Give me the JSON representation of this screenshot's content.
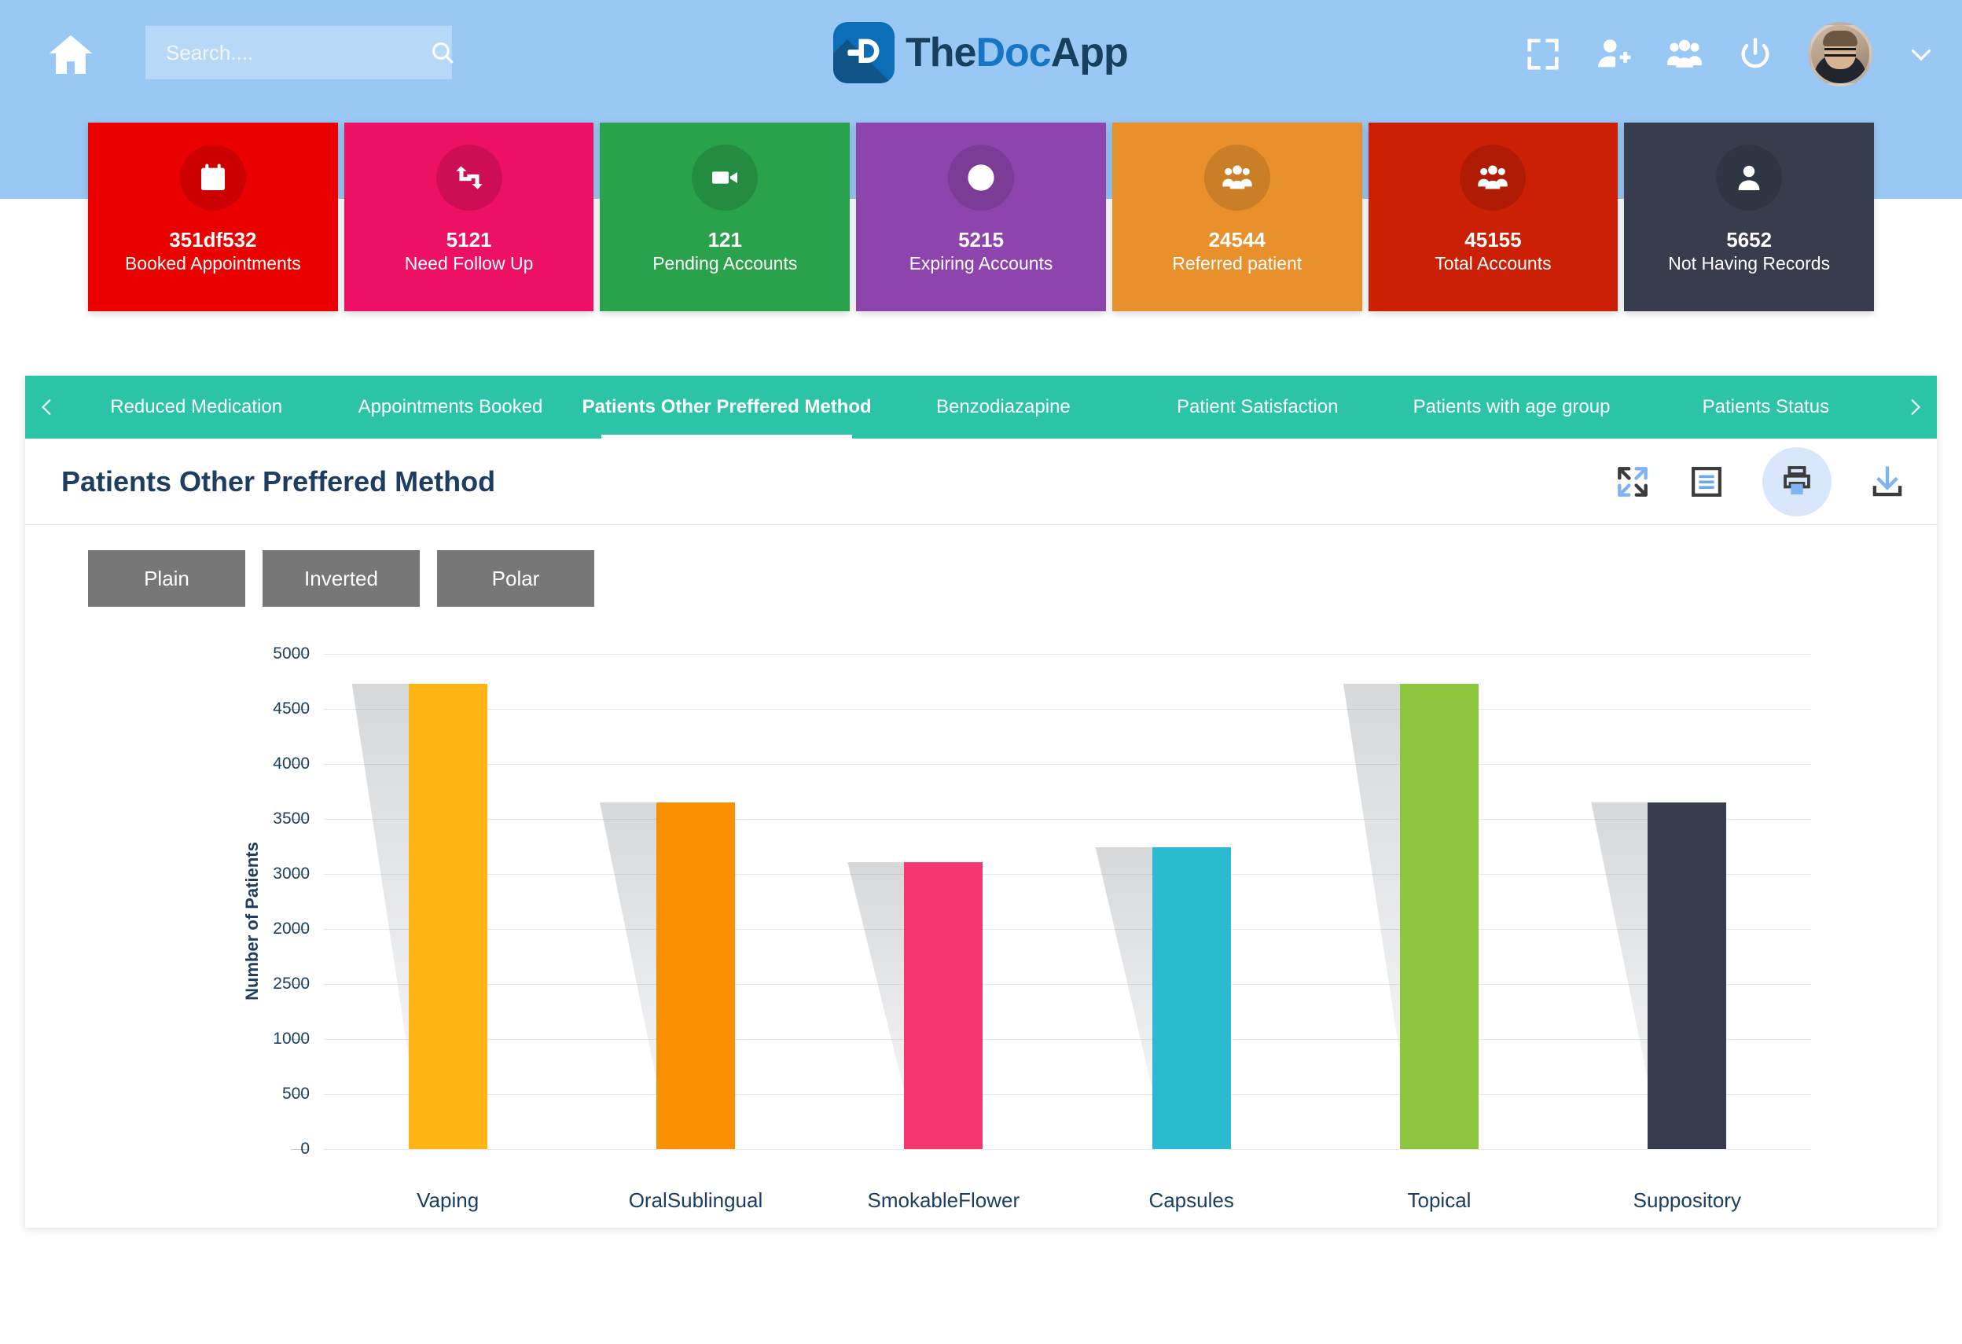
{
  "topbar": {
    "home_icon": "home-icon",
    "search": {
      "placeholder": "Search....",
      "value": "",
      "icon": "search-icon"
    },
    "brand": {
      "part1": "The",
      "part2": "Doc",
      "part3": "App",
      "mark_icon": "doc-logo-icon"
    },
    "actions": [
      {
        "name": "fullscreen-icon",
        "label": "Fullscreen"
      },
      {
        "name": "add-user-icon",
        "label": "Add User"
      },
      {
        "name": "users-group-icon",
        "label": "Users"
      },
      {
        "name": "power-icon",
        "label": "Power"
      }
    ],
    "avatar_name": "avatar",
    "chevron_icon": "chevron-down-icon",
    "background_color": "#9ac8f5"
  },
  "cards": [
    {
      "value": "351df532",
      "label": "Booked Appointments",
      "color": "#eb0000",
      "icon": "calendar-icon"
    },
    {
      "value": "5121",
      "label": "Need Follow Up",
      "color": "#ec1164",
      "icon": "retweet-icon"
    },
    {
      "value": "121",
      "label": "Pending Accounts",
      "color": "#2aa14b",
      "icon": "video-camera-icon"
    },
    {
      "value": "5215",
      "label": "Expiring Accounts",
      "color": "#8e44ad",
      "icon": "clock-icon"
    },
    {
      "value": "24544",
      "label": "Referred patient",
      "color": "#e8912c",
      "icon": "users-group-icon"
    },
    {
      "value": "45155",
      "label": "Total Accounts",
      "color": "#cb2006",
      "icon": "users-group-icon"
    },
    {
      "value": "5652",
      "label": "Not Having Records",
      "color": "#383d4d",
      "icon": "user-icon"
    }
  ],
  "tabs": {
    "prev_icon": "chevron-left-icon",
    "next_icon": "chevron-right-icon",
    "items": [
      {
        "label": "Reduced Medication",
        "active": false
      },
      {
        "label": "Appointments Booked",
        "active": false
      },
      {
        "label": "Patients Other Preffered Method",
        "active": true
      },
      {
        "label": "Benzodiazapine",
        "active": false
      },
      {
        "label": "Patient Satisfaction",
        "active": false
      },
      {
        "label": "Patients with age group",
        "active": false
      },
      {
        "label": "Patients Status",
        "active": false
      }
    ],
    "accent_color": "#2bc4a6"
  },
  "panel": {
    "title": "Patients Other Preffered Method",
    "tools": [
      {
        "name": "expand-arrows-icon",
        "label": "Expand",
        "highlighted": false
      },
      {
        "name": "document-list-icon",
        "label": "Data table",
        "highlighted": false
      },
      {
        "name": "print-icon",
        "label": "Print",
        "highlighted": true
      },
      {
        "name": "download-icon",
        "label": "Download",
        "highlighted": false
      }
    ],
    "chart_type_buttons": [
      {
        "label": "Plain"
      },
      {
        "label": "Inverted"
      },
      {
        "label": "Polar"
      }
    ]
  },
  "chart_data": {
    "type": "bar",
    "title": "Patients Other Preffered Method",
    "xlabel": "",
    "ylabel": "Number of Patients",
    "categories": [
      "Vaping",
      "OralSublingual",
      "SmokableFlower",
      "Capsules",
      "Topical",
      "Suppository"
    ],
    "values": [
      4700,
      3500,
      2900,
      3050,
      4700,
      3500
    ],
    "colors": [
      "#fdb515",
      "#fa9000",
      "#f5356e",
      "#2bbbd1",
      "#8cc63e",
      "#383d4d"
    ],
    "ytick_labels": [
      "5000",
      "4500",
      "4000",
      "3500",
      "3000",
      "2000",
      "2500",
      "1000",
      "500",
      "0"
    ],
    "ylim": [
      0,
      5000
    ],
    "grid": true,
    "legend": "none"
  }
}
